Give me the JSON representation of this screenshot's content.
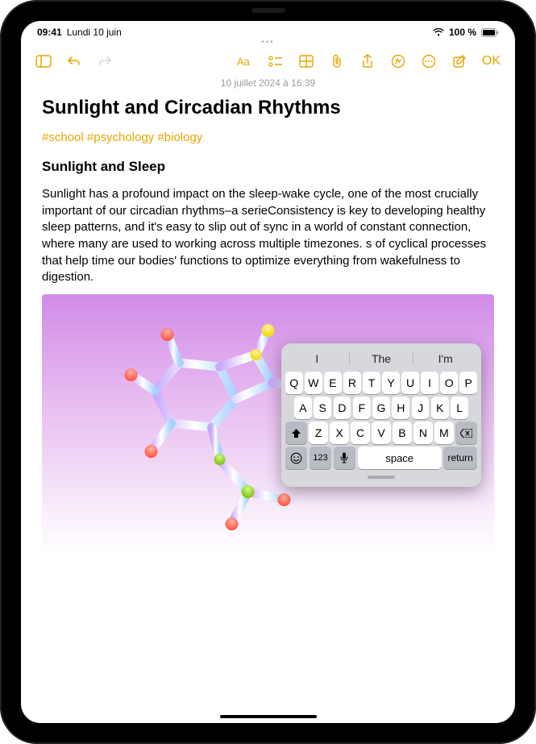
{
  "status": {
    "time": "09:41",
    "date": "Lundi 10 juin",
    "battery_pct": "100 %"
  },
  "toolbar": {
    "done_label": "OK"
  },
  "note": {
    "modified": "10 juillet 2024 à 16:39",
    "title": "Sunlight and Circadian Rhythms",
    "tags": "#school #psychology #biology",
    "subtitle": "Sunlight and Sleep",
    "body": "Sunlight has a profound impact on the sleep-wake cycle, one of the most crucially important of our circadian rhythms–a serieConsistency is key to developing healthy sleep patterns, and it's easy to slip out of sync in a world of constant connection, where many are used to working across multiple timezones. s of cyclical processes that help time our bodies' functions to optimize everything from wakefulness to digestion."
  },
  "keyboard": {
    "suggestions": [
      "I",
      "The",
      "I'm"
    ],
    "rows": [
      [
        "Q",
        "W",
        "E",
        "R",
        "T",
        "Y",
        "U",
        "I",
        "O",
        "P"
      ],
      [
        "A",
        "S",
        "D",
        "F",
        "G",
        "H",
        "J",
        "K",
        "L"
      ],
      [
        "Z",
        "X",
        "C",
        "V",
        "B",
        "N",
        "M"
      ]
    ],
    "space": "space",
    "return": "return",
    "numbers": "123"
  }
}
